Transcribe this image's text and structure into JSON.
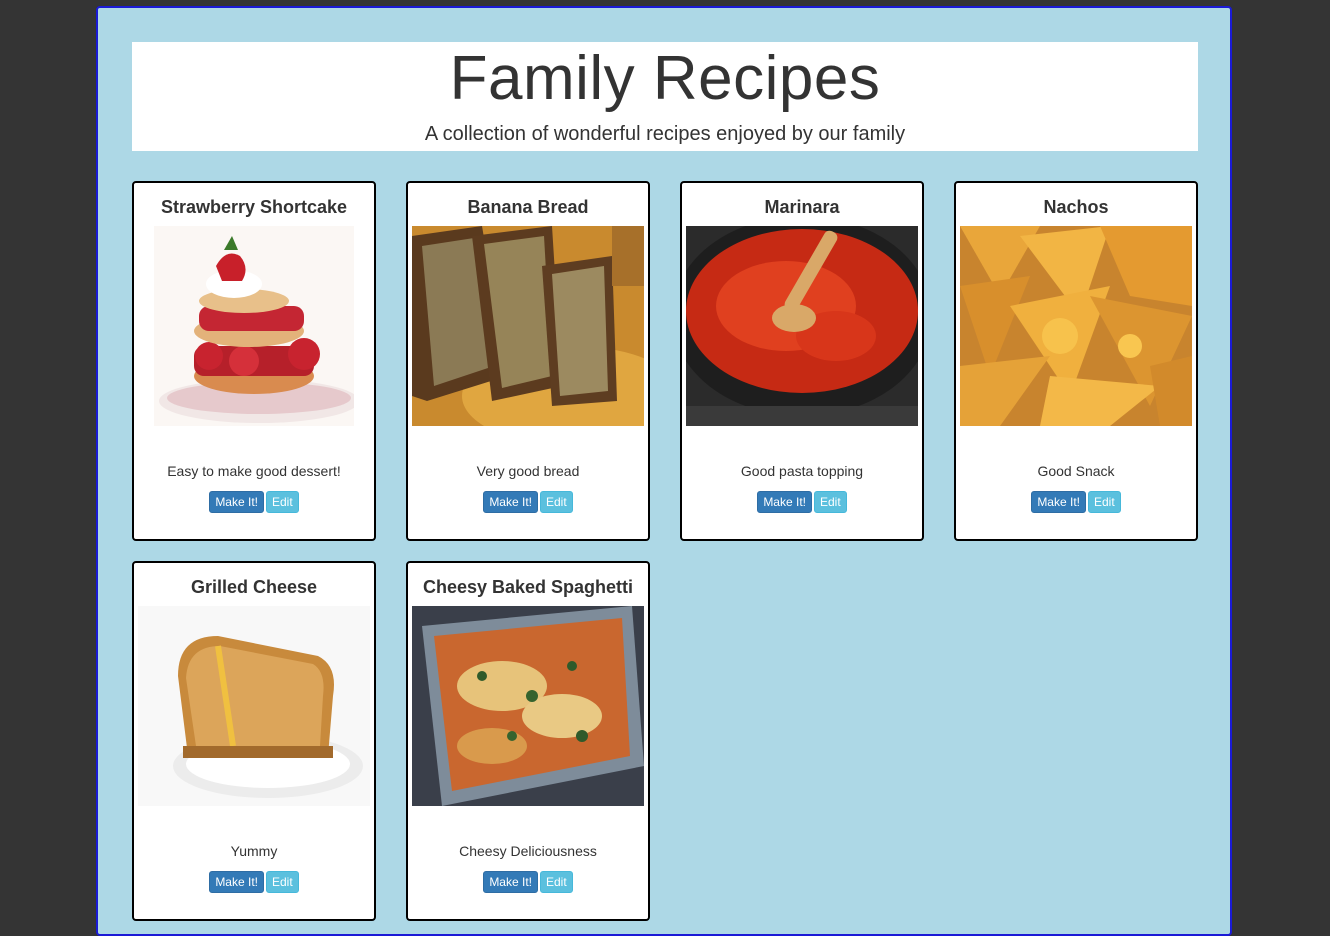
{
  "header": {
    "title": "Family Recipes",
    "subtitle": "A collection of wonderful recipes enjoyed by our family"
  },
  "colors": {
    "page_bg": "#343434",
    "frame_bg": "#add8e6",
    "frame_border": "#1a1ad6",
    "primary_button": "#337ab7",
    "info_button": "#5bc0de"
  },
  "recipes": [
    {
      "title": "Strawberry Shortcake",
      "image": "strawberry-shortcake-photo",
      "description": "Easy to make good dessert!",
      "make_label": "Make It!",
      "edit_label": "Edit"
    },
    {
      "title": "Banana Bread",
      "image": "banana-bread-photo",
      "description": "Very good bread",
      "make_label": "Make It!",
      "edit_label": "Edit"
    },
    {
      "title": "Marinara",
      "image": "marinara-photo",
      "description": "Good pasta topping",
      "make_label": "Make It!",
      "edit_label": "Edit"
    },
    {
      "title": "Nachos",
      "image": "nachos-photo",
      "description": "Good Snack",
      "make_label": "Make It!",
      "edit_label": "Edit"
    },
    {
      "title": "Grilled Cheese",
      "image": "grilled-cheese-photo",
      "description": "Yummy",
      "make_label": "Make It!",
      "edit_label": "Edit"
    },
    {
      "title": "Cheesy Baked Spaghetti",
      "image": "baked-spaghetti-photo",
      "description": "Cheesy Deliciousness",
      "make_label": "Make It!",
      "edit_label": "Edit"
    }
  ]
}
